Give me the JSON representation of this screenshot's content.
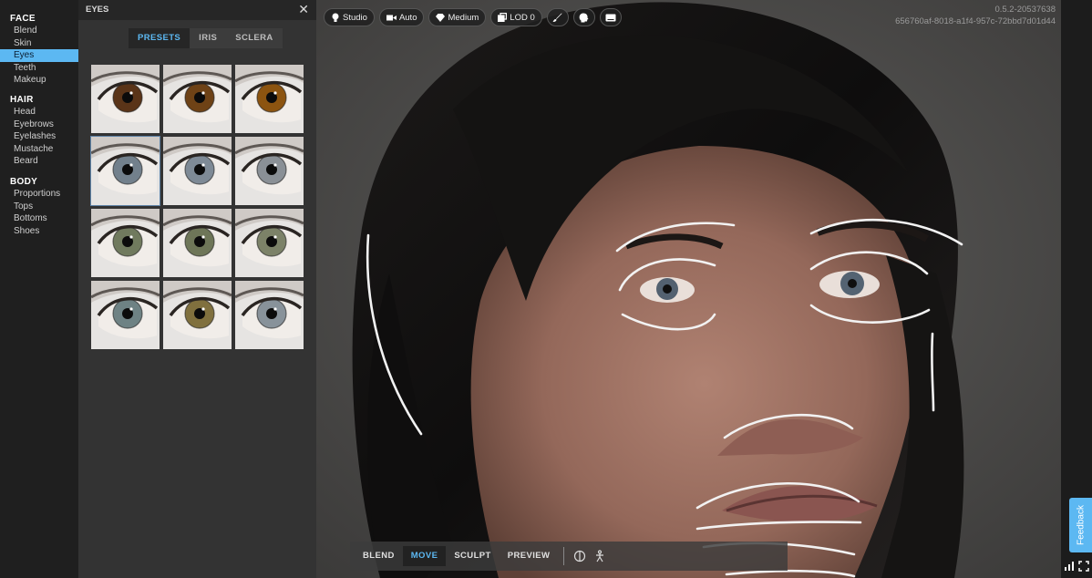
{
  "sidebar": {
    "sections": [
      {
        "title": "FACE",
        "items": [
          "Blend",
          "Skin",
          "Eyes",
          "Teeth",
          "Makeup"
        ]
      },
      {
        "title": "HAIR",
        "items": [
          "Head",
          "Eyebrows",
          "Eyelashes",
          "Mustache",
          "Beard"
        ]
      },
      {
        "title": "BODY",
        "items": [
          "Proportions",
          "Tops",
          "Bottoms",
          "Shoes"
        ]
      }
    ],
    "active_item": "Eyes"
  },
  "panel": {
    "title": "EYES",
    "close_icon": "close-icon",
    "tabs": [
      {
        "label": "PRESETS",
        "active": true
      },
      {
        "label": "IRIS",
        "active": false
      },
      {
        "label": "SCLERA",
        "active": false
      }
    ],
    "presets": [
      {
        "iris": "#5a3418"
      },
      {
        "iris": "#6e4216"
      },
      {
        "iris": "#8c5410"
      },
      {
        "iris": "#72808c",
        "selected": true
      },
      {
        "iris": "#7e8a96"
      },
      {
        "iris": "#8a9096"
      },
      {
        "iris": "#707a5e"
      },
      {
        "iris": "#6e7658"
      },
      {
        "iris": "#7c8268"
      },
      {
        "iris": "#6e8284"
      },
      {
        "iris": "#80703e"
      },
      {
        "iris": "#88929a"
      }
    ]
  },
  "viewport": {
    "toolbar": [
      {
        "icon": "light-bulb-icon",
        "label": "Studio"
      },
      {
        "icon": "camera-icon",
        "label": "Auto"
      },
      {
        "icon": "diamond-icon",
        "label": "Medium"
      },
      {
        "icon": "lod-icon",
        "label": "LOD 0"
      },
      {
        "icon": "brush-icon",
        "label": ""
      },
      {
        "icon": "head-icon",
        "label": ""
      },
      {
        "icon": "screen-icon",
        "label": ""
      }
    ],
    "version": "0.5.2-20537638",
    "build_id": "656760af-8018-a1f4-957c-72bbd7d01d44",
    "modes": [
      {
        "label": "BLEND",
        "active": false
      },
      {
        "label": "MOVE",
        "active": true
      },
      {
        "label": "SCULPT",
        "active": false
      },
      {
        "label": "PREVIEW",
        "active": false
      }
    ],
    "extra_icons": [
      "symmetry-icon",
      "skeleton-icon"
    ]
  },
  "right": {
    "feedback_label": "Feedback",
    "icons": [
      "signal-icon",
      "fullscreen-icon"
    ]
  },
  "colors": {
    "accent": "#5cb8f2",
    "panel": "#333333",
    "sidebar": "#1f1f1f"
  }
}
